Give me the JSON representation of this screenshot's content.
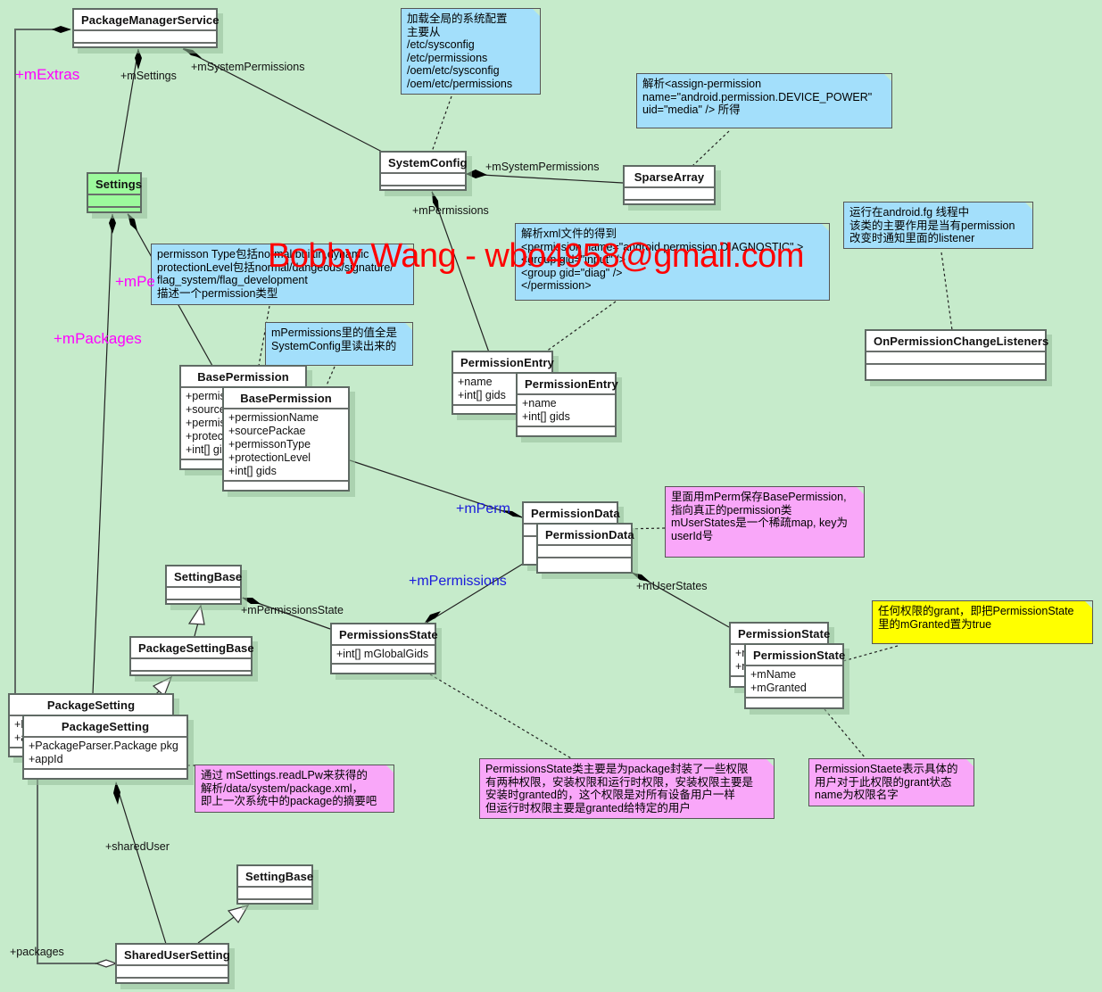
{
  "classes": {
    "package_manager_service": {
      "name": "PackageManagerService",
      "attrs": []
    },
    "settings": {
      "name": "Settings",
      "attrs": []
    },
    "system_config": {
      "name": "SystemConfig",
      "attrs": []
    },
    "sparse_array": {
      "name": "SparseArray",
      "attrs": []
    },
    "on_permission_change_listeners": {
      "name": "OnPermissionChangeListeners",
      "attrs": []
    },
    "base_permission_back": {
      "name": "BasePermission",
      "attrs": [
        "+permis",
        "+source",
        "+permis",
        "+protec",
        "+int[] gi"
      ]
    },
    "base_permission": {
      "name": "BasePermission",
      "attrs": [
        "+permissionName",
        "+sourcePackae",
        "+permissonType",
        "+protectionLevel",
        "+int[] gids"
      ]
    },
    "permission_entry_back": {
      "name": "PermissionEntry",
      "attrs": [
        "+name",
        "+int[] gids"
      ]
    },
    "permission_entry": {
      "name": "PermissionEntry",
      "attrs": [
        "+name",
        "+int[] gids"
      ]
    },
    "permission_data_back": {
      "name": "PermissionData",
      "attrs": []
    },
    "permission_data": {
      "name": "PermissionData",
      "attrs": []
    },
    "setting_base_top": {
      "name": "SettingBase",
      "attrs": []
    },
    "package_setting_base": {
      "name": "PackageSettingBase",
      "attrs": []
    },
    "permissions_state": {
      "name": "PermissionsState",
      "attrs": [
        "+int[] mGlobalGids"
      ]
    },
    "permission_state_back": {
      "name": "PermissionState",
      "attrs": [
        "+r",
        "+r"
      ]
    },
    "permission_state": {
      "name": "PermissionState",
      "attrs": [
        "+mName",
        "+mGranted"
      ]
    },
    "package_setting_back": {
      "name": "PackageSetting",
      "attrs": [
        "+F",
        "+a"
      ]
    },
    "package_setting": {
      "name": "PackageSetting",
      "attrs": [
        "+PackageParser.Package pkg",
        "+appId"
      ]
    },
    "setting_base_bottom": {
      "name": "SettingBase",
      "attrs": []
    },
    "shared_user_setting": {
      "name": "SharedUserSetting",
      "attrs": []
    }
  },
  "notes": {
    "system_config_note": "加载全局的系统配置\n主要从\n/etc/sysconfig\n/etc/permissions\n/oem/etc/sysconfig\n/oem/etc/permissions",
    "sparse_array_note": "解析<assign-permission\nname=\"android.permission.DEVICE_POWER\"\nuid=\"media\" /> 所得",
    "listeners_note": "运行在android.fg 线程中\n该类的主要作用是当有permission\n改变时通知里面的listener",
    "base_permission_type_note": "permisson Type包括normal,builtin,dynamic\nprotectionLevel包括normal/dangeous/signature/\nflag_system/flag_development\n描述一个permission类型",
    "mpermissions_note": "mPermissions里的值全是\nSystemConfig里读出来的",
    "permission_entry_note": "解析xml文件的得到\n<permission name=\"android.permission.DIAGNOSTIC\" >\n<group gid=\"input\" />\n<group gid=\"diag\" />\n</permission>",
    "permission_data_note": "里面用mPerm保存BasePermission,\n指向真正的permission类\nmUserStates是一个稀疏map, key为\nuserId号",
    "grant_note": "任何权限的grant，即把PermissionState\n里的mGranted置为true",
    "package_setting_note": "通过 mSettings.readLPw来获得的\n解析/data/system/package.xml，\n即上一次系统中的package的摘要吧",
    "permissions_state_note": "PermissionsState类主要是为package封装了一些权限\n有两种权限，安装权限和运行时权限，安装权限主要是\n安装时granted的，这个权限是对所有设备用户一样\n但运行时权限主要是granted给特定的用户",
    "permission_state_note": "PermissionStaete表示具体的\n用户对于此权限的grant状态\nname为权限名字"
  },
  "labels": {
    "m_extras": "+mExtras",
    "m_settings": "+mSettings",
    "m_system_permissions_top": "+mSystemPermissions",
    "m_system_permissions": "+mSystemPermissions",
    "m_permissions_sc": "+mPermissions",
    "m_pe": "+mPe",
    "m_packages": "+mPackages",
    "m_perm": "+mPerm",
    "m_permissions_blue": "+mPermissions",
    "m_user_states": "+mUserStates",
    "m_permissions_state": "+mPermissionsState",
    "shared_user": "+sharedUser",
    "packages": "+packages"
  },
  "watermark": "Bobby Wang - wbo4958@gmail.com",
  "colors": {
    "background": "#c6ebcb",
    "note_blue": "#a3dffb",
    "note_pink": "#f9a7f9",
    "note_yellow": "#ffff00",
    "settings_green": "#9cfa9c",
    "label_magenta": "#ff00ff",
    "label_blue": "#1a1adb",
    "watermark_red": "#ff0000"
  }
}
